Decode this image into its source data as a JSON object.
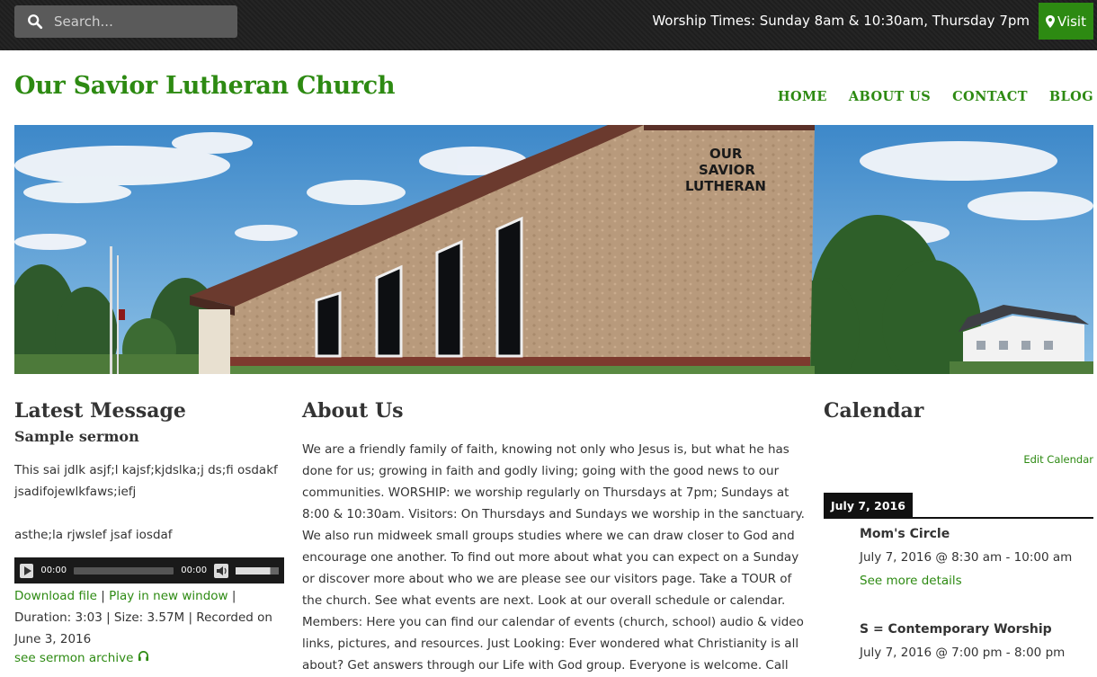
{
  "topbar": {
    "search_placeholder": "Search...",
    "worship_times": "Worship Times: Sunday 8am & 10:30am, Thursday 7pm",
    "visit_label": "Visit"
  },
  "header": {
    "title": "Our Savior Lutheran Church",
    "nav": [
      "HOME",
      "ABOUT US",
      "CONTACT",
      "BLOG"
    ]
  },
  "hero": {
    "sign_text": [
      "OUR",
      "SAVIOR",
      "LUTHERAN"
    ]
  },
  "latest_message": {
    "heading": "Latest Message",
    "sermon_title": "Sample sermon",
    "paragraph1": "This sai jdlk asjf;l kajsf;kjdslka;j ds;fi osdakf jsadifojewlkfaws;iefj",
    "paragraph2": "asthe;la rjwslef jsaf iosdaf",
    "player": {
      "current_time": "00:00",
      "duration_time": "00:00",
      "progress": 0,
      "volume": 0.8
    },
    "download": "Download file",
    "play_window": "Play in new window",
    "details": "Duration: 3:03 | Size: 3.57M | Recorded on June 3, 2016",
    "archive": "see sermon archive"
  },
  "about": {
    "heading": "About Us",
    "text": "We are a friendly family of faith, knowing not only who Jesus is, but what he has done for us; growing in faith and godly living; going with the good news to our communities.   WORSHIP: we worship regularly on Thursdays at 7pm; Sundays at 8:00 & 10:30am.   Visitors: On Thursdays and Sundays we worship in the sanctuary. We also run midweek small groups studies where we can draw closer to God and encourage one another. To find out more about what you can expect on a Sunday or discover more about who we are please see our visitors page.  Take a TOUR of the church.  See what events are next.  Look at our overall schedule or calendar. Members: Here you can find our calendar of events (church, school) audio & video links, pictures, and resources.  Just Looking: Ever wondered what Christianity is all about? Get answers through our Life with God group.  Everyone is welcome. Call and"
  },
  "calendar": {
    "heading": "Calendar",
    "edit_label": "Edit Calendar",
    "date": "July 7, 2016",
    "events": [
      {
        "title": "Mom's Circle",
        "time": "July 7, 2016 @ 8:30 am - 10:00 am",
        "more": "See more details"
      },
      {
        "title": "S = Contemporary Worship",
        "time": "July 7, 2016 @ 7:00 pm - 8:00 pm"
      }
    ]
  },
  "colors": {
    "brand_green": "#2d8a12",
    "topbar_bg": "#1e1e1e"
  }
}
